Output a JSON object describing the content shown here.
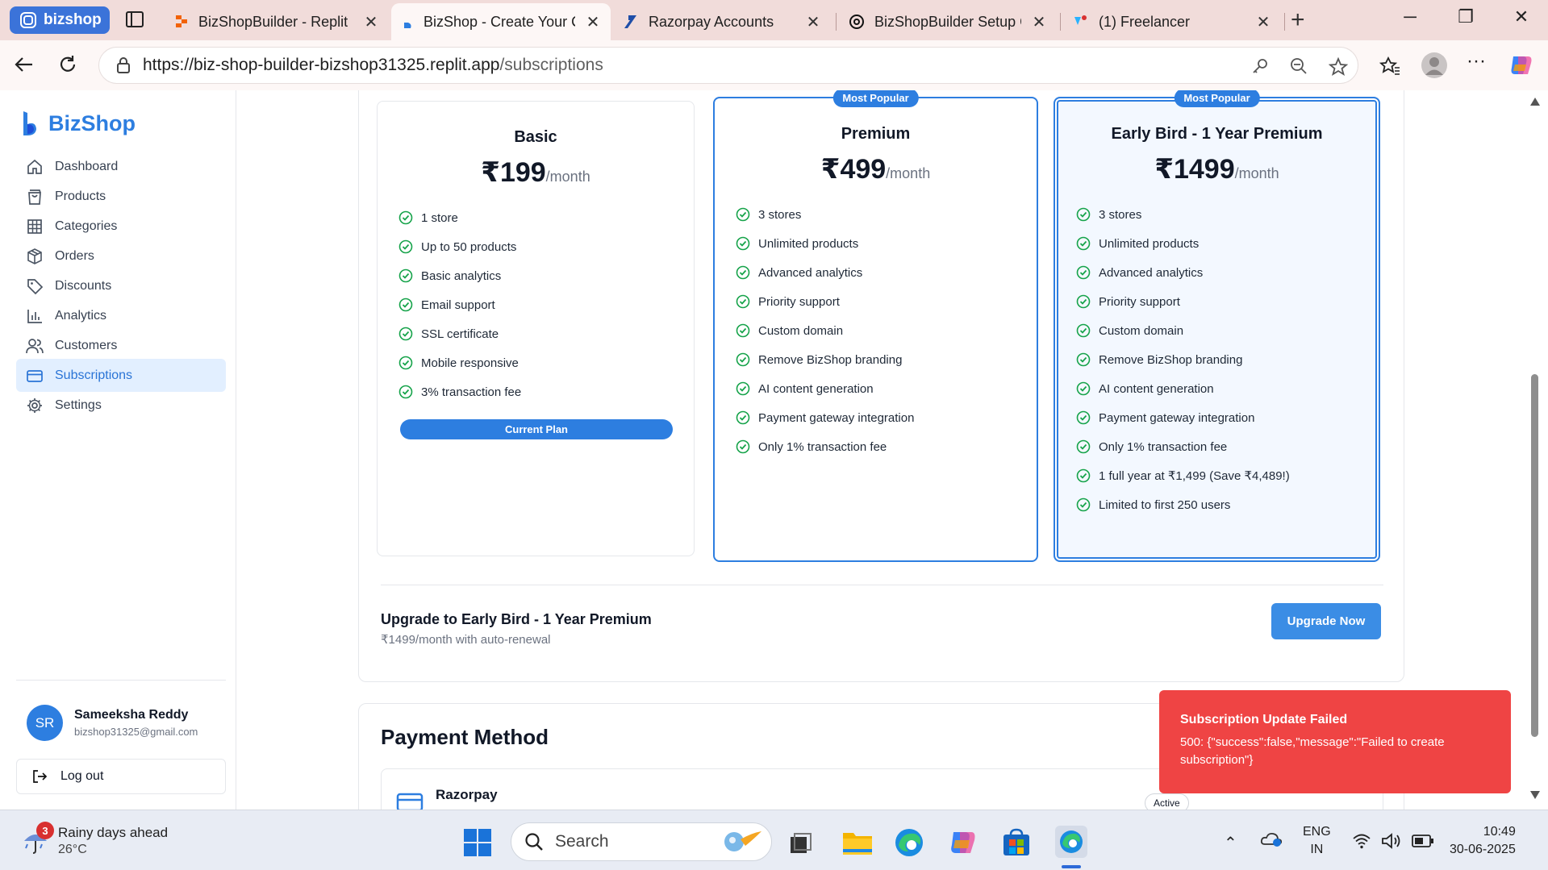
{
  "browser": {
    "profile_label": "bizshop",
    "tabs": [
      {
        "title": "BizShopBuilder - Replit",
        "active": false
      },
      {
        "title": "BizShop - Create Your C",
        "active": true
      },
      {
        "title": "Razorpay Accounts",
        "active": false
      },
      {
        "title": "BizShopBuilder Setup G",
        "active": false
      },
      {
        "title": "(1) Freelancer",
        "active": false
      }
    ],
    "url_host": "https://biz-shop-builder-bizshop31325.replit.app",
    "url_path": "/subscriptions"
  },
  "sidebar": {
    "brand": "BizShop",
    "items": [
      {
        "label": "Dashboard",
        "icon": "home-icon"
      },
      {
        "label": "Products",
        "icon": "shopping-bag-icon"
      },
      {
        "label": "Categories",
        "icon": "grid-icon"
      },
      {
        "label": "Orders",
        "icon": "package-icon"
      },
      {
        "label": "Discounts",
        "icon": "tag-icon"
      },
      {
        "label": "Analytics",
        "icon": "bar-chart-icon"
      },
      {
        "label": "Customers",
        "icon": "users-icon"
      },
      {
        "label": "Subscriptions",
        "icon": "credit-card-icon",
        "active": true
      },
      {
        "label": "Settings",
        "icon": "gear-icon"
      }
    ],
    "user": {
      "initials": "SR",
      "name": "Sameeksha Reddy",
      "email": "bizshop31325@gmail.com"
    },
    "logout_label": "Log out"
  },
  "plans": [
    {
      "name": "Basic",
      "price": "₹199",
      "period": "/month",
      "badge": "",
      "features": [
        "1 store",
        "Up to 50 products",
        "Basic analytics",
        "Email support",
        "SSL certificate",
        "Mobile responsive",
        "3% transaction fee"
      ],
      "button_label": "Current Plan"
    },
    {
      "name": "Premium",
      "price": "₹499",
      "period": "/month",
      "badge": "Most Popular",
      "features": [
        "3 stores",
        "Unlimited products",
        "Advanced analytics",
        "Priority support",
        "Custom domain",
        "Remove BizShop branding",
        "AI content generation",
        "Payment gateway integration",
        "Only 1% transaction fee"
      ]
    },
    {
      "name": "Early Bird - 1 Year Premium",
      "price": "₹1499",
      "period": "/month",
      "badge": "Most Popular",
      "features": [
        "3 stores",
        "Unlimited products",
        "Advanced analytics",
        "Priority support",
        "Custom domain",
        "Remove BizShop branding",
        "AI content generation",
        "Payment gateway integration",
        "Only 1% transaction fee",
        "1 full year at ₹1,499 (Save ₹4,489!)",
        "Limited to first 250 users"
      ]
    }
  ],
  "upgrade": {
    "title": "Upgrade to Early Bird - 1 Year Premium",
    "subtitle": "₹1499/month with auto-renewal",
    "button_label": "Upgrade Now"
  },
  "payment": {
    "title": "Payment Method",
    "method_name": "Razorpay",
    "status": "Active"
  },
  "toast": {
    "title": "Subscription Update Failed",
    "message": "500: {\"success\":false,\"message\":\"Failed to create subscription\"}"
  },
  "taskbar": {
    "weather_title": "Rainy days ahead",
    "weather_temp": "26°C",
    "weather_badge": "3",
    "search_label": "Search",
    "lang_1": "ENG",
    "lang_2": "IN",
    "time": "10:49",
    "date": "30-06-2025"
  },
  "colors": {
    "accent": "#2d7ee0",
    "toast": "#ef4444",
    "check": "#16a34a"
  }
}
